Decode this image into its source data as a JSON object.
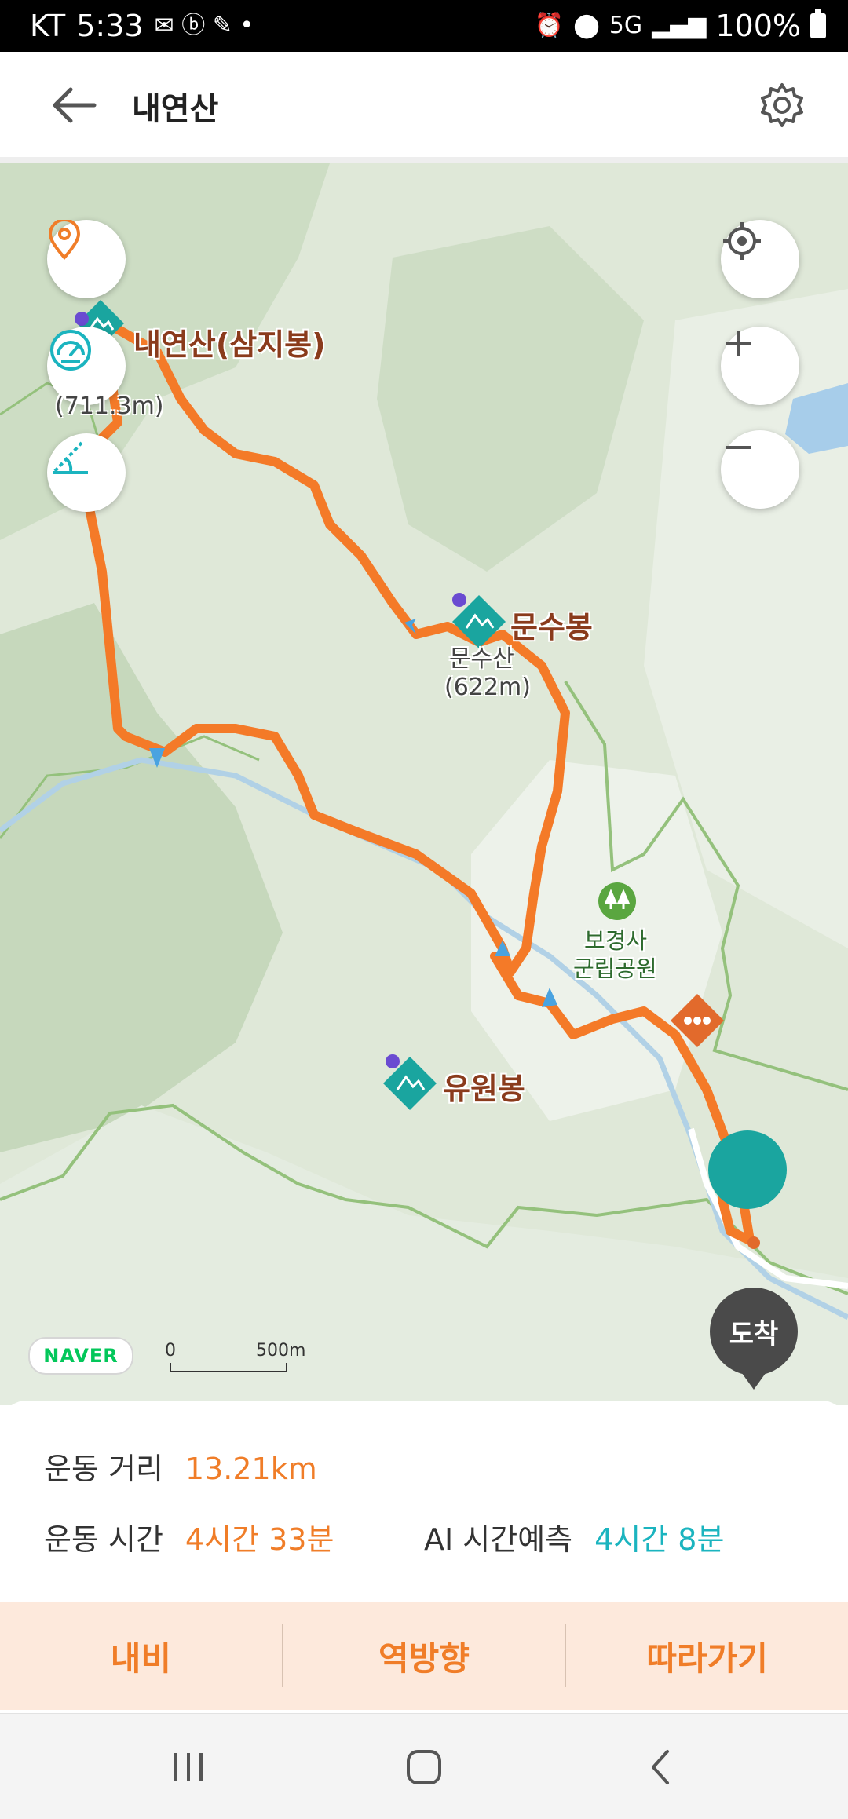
{
  "status_bar": {
    "carrier": "KT",
    "time": "5:33",
    "battery": "100%",
    "network": "5G"
  },
  "app_bar": {
    "title": "내연산"
  },
  "map": {
    "peaks": [
      {
        "name": "내연산(삼지봉)",
        "elevation": "(711.3m)"
      },
      {
        "name": "문수봉",
        "sub": "문수산",
        "elevation": "(622m)"
      },
      {
        "name": "유원봉"
      }
    ],
    "park_name_line1": "보경사",
    "park_name_line2": "군립공원",
    "scale_start": "0",
    "scale_end": "500m",
    "provider": "NAVER",
    "arrival_label": "도착",
    "colors": {
      "route": "#f47a28",
      "marker": "#1aa59f",
      "land": "#d9e4d1"
    }
  },
  "stats": {
    "distance_label": "운동 거리",
    "distance_value": "13.21km",
    "time_label": "운동 시간",
    "time_value": "4시간 33분",
    "ai_label": "AI 시간예측",
    "ai_value": "4시간 8분"
  },
  "actions": {
    "navi": "내비",
    "reverse": "역방향",
    "follow": "따라가기"
  }
}
